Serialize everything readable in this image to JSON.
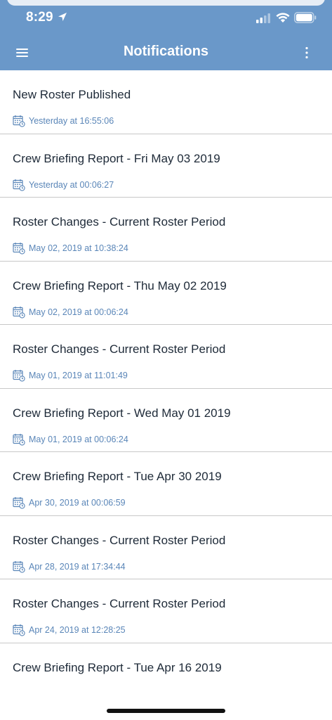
{
  "status_bar": {
    "time": "8:29",
    "icons": [
      "location-arrow-icon",
      "cellular-signal-icon",
      "wifi-icon",
      "battery-icon"
    ]
  },
  "header": {
    "title": "Notifications",
    "menu_icon": "hamburger-menu-icon",
    "more_icon": "more-vertical-icon"
  },
  "colors": {
    "header_bg": "#6a98c9",
    "title_text": "#1e2a38",
    "date_text": "#5a86b8",
    "divider": "#c8c8c8"
  },
  "notifications": [
    {
      "title": "New Roster Published",
      "date": "Yesterday at 16:55:06",
      "icon": "calendar-clock-icon"
    },
    {
      "title": "Crew Briefing Report - Fri May 03 2019",
      "date": "Yesterday at 00:06:27",
      "icon": "calendar-clock-icon"
    },
    {
      "title": "Roster Changes - Current Roster Period",
      "date": "May 02, 2019 at 10:38:24",
      "icon": "calendar-clock-icon"
    },
    {
      "title": "Crew Briefing Report - Thu May 02 2019",
      "date": "May 02, 2019 at 00:06:24",
      "icon": "calendar-clock-icon"
    },
    {
      "title": "Roster Changes - Current Roster Period",
      "date": "May 01, 2019 at 11:01:49",
      "icon": "calendar-clock-icon"
    },
    {
      "title": "Crew Briefing Report - Wed May 01 2019",
      "date": "May 01, 2019 at 00:06:24",
      "icon": "calendar-clock-icon"
    },
    {
      "title": "Crew Briefing Report - Tue Apr 30 2019",
      "date": "Apr 30, 2019 at 00:06:59",
      "icon": "calendar-clock-icon"
    },
    {
      "title": "Roster Changes - Current Roster Period",
      "date": "Apr 28, 2019 at 17:34:44",
      "icon": "calendar-clock-icon"
    },
    {
      "title": "Roster Changes - Current Roster Period",
      "date": "Apr 24, 2019 at 12:28:25",
      "icon": "calendar-clock-icon"
    },
    {
      "title": "Crew Briefing Report - Tue Apr 16 2019",
      "date": "",
      "icon": ""
    }
  ]
}
